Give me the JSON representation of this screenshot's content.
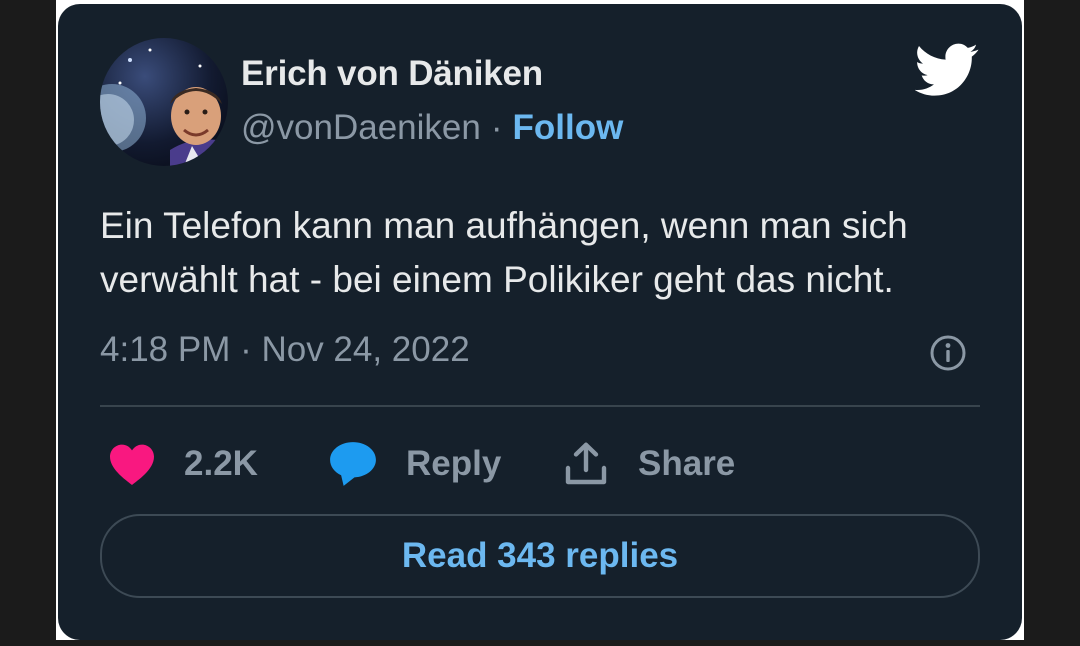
{
  "tweet": {
    "author_name": "Erich von Däniken",
    "author_handle": "@vonDaeniken",
    "separator": "·",
    "follow_label": "Follow",
    "text": "Ein Telefon kann man aufhängen, wenn man sich verwählt hat - bei einem Polikiker geht das nicht.",
    "timestamp": "4:18 PM · Nov 24, 2022"
  },
  "actions": {
    "likes_count": "2.2K",
    "reply_label": "Reply",
    "share_label": "Share"
  },
  "read_replies_label": "Read 343 replies",
  "colors": {
    "card_background": "#15202b",
    "like_heart": "#f91880",
    "reply_bubble": "#1d9bf0",
    "link_blue": "#6cb8f0",
    "muted_text": "#8b98a5"
  }
}
